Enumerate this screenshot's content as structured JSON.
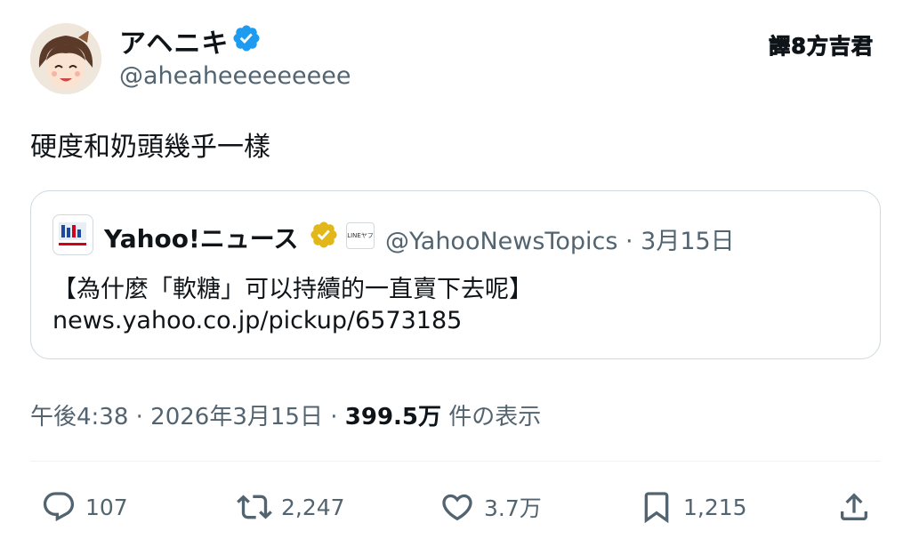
{
  "author": {
    "display_name": "アヘニキ",
    "handle": "@aheaheeeeeeeee",
    "verified_color": "#1d9bf0",
    "avatar_icon": "anime-avatar"
  },
  "watermark": "譯8方吉君",
  "tweet": {
    "text": "硬度和奶頭幾乎一樣"
  },
  "quote": {
    "name": "Yahoo!ニュース",
    "badge_color": "#e2b719",
    "affiliate_label": "LINEヤフー",
    "handle_date": "@YahooNewsTopics · 3月15日",
    "title": "【為什麼「軟糖」可以持續的一直賣下去呢】",
    "link": "news.yahoo.co.jp/pickup/6573185"
  },
  "meta": {
    "time_date": "午後4:38 · 2026年3月15日 · ",
    "views": "399.5万",
    "views_label": " 件の表示"
  },
  "actions": {
    "replies": "107",
    "retweets": "2,247",
    "likes": "3.7万",
    "bookmarks": "1,215"
  }
}
